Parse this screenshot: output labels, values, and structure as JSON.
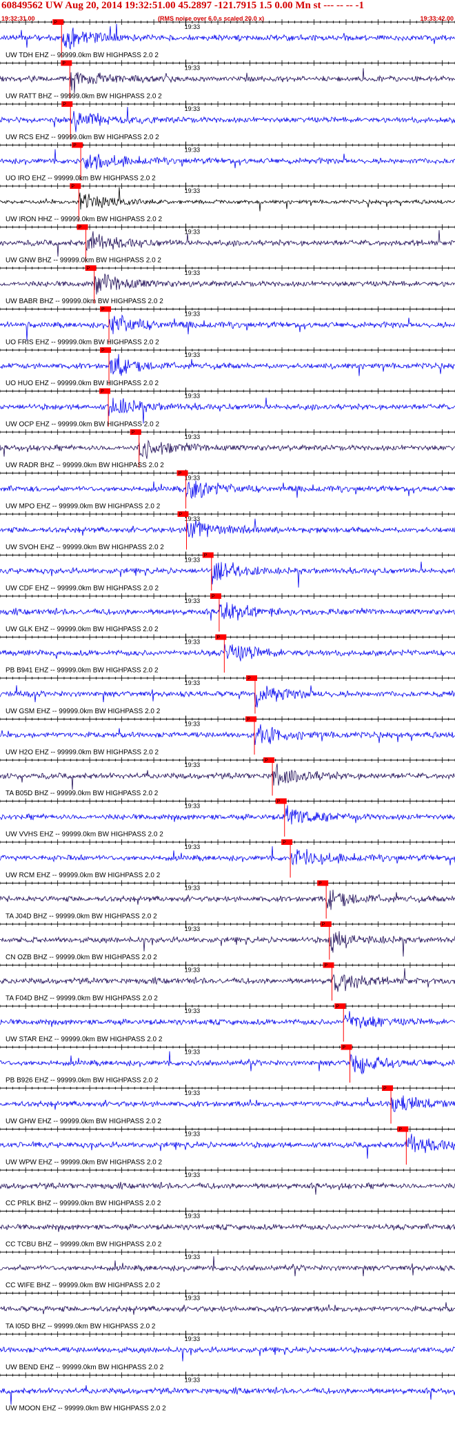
{
  "header": {
    "title": "60849562 UW Aug 20, 2014 19:32:51.00   45.2897 -121.7915  1.5 0.00 Mn st --- -- --   -1",
    "start_time": "19:32:31.00",
    "rms_note": "(RMS noise over 6.0 s scaled 20.0 x)",
    "end_time": "19:33:42.00"
  },
  "colors": {
    "trace_blue": "#0000ee",
    "trace_dark": "#1c0a55",
    "trace_black": "#000000",
    "pick_red": "#ff0000",
    "header_red": "#d40000"
  },
  "chart_data": {
    "type": "line",
    "time_axis": {
      "start": "19:32:31.00",
      "end": "19:33:42.00",
      "minute_label": "19:33"
    },
    "traces": [
      {
        "label": "UW TDH EHZ -- 99999.0km BW  HIGHPASS  2.0  2",
        "pick": "P",
        "pick_t": 9.6,
        "color": "blue"
      },
      {
        "label": "UW RATT BHZ -- 99999.0km BW  HIGHPASS  2.0  2",
        "pick": "P",
        "pick_t": 10.9,
        "color": "dark"
      },
      {
        "label": "UW RCS EHZ -- 99999.0km BW  HIGHPASS  2.0  2",
        "pick": "P",
        "pick_t": 11.0,
        "color": "blue"
      },
      {
        "label": "UO IRO EHZ -- 99999.0km BW  HIGHPASS  2.0  2",
        "pick": "P",
        "pick_t": 12.6,
        "color": "blue"
      },
      {
        "label": "UW IRON HHZ -- 99999.0km BW  HIGHPASS  2.0  2",
        "pick": "P",
        "pick_t": 12.3,
        "color": "black"
      },
      {
        "label": "UW GNW BHZ -- 99999.0km BW  HIGHPASS  2.0  2",
        "pick": "P",
        "pick_t": 13.4,
        "color": "dark"
      },
      {
        "label": "UW BABR BHZ -- 99999.0km BW  HIGHPASS  2.0  2",
        "pick": "P",
        "pick_t": 14.7,
        "color": "dark"
      },
      {
        "label": "UO FRIS EHZ -- 99999.0km BW  HIGHPASS  2.0  2",
        "pick": "P",
        "pick_t": 17.0,
        "color": "blue"
      },
      {
        "label": "UO HUO EHZ -- 99999.0km BW  HIGHPASS  2.0  2",
        "pick": "P",
        "pick_t": 17.0,
        "color": "blue"
      },
      {
        "label": "UW OCP EHZ -- 99999.0km BW  HIGHPASS  2.0  2",
        "pick": "P",
        "pick_t": 16.9,
        "color": "blue"
      },
      {
        "label": "UW RADR BHZ -- 99999.0km BW  HIGHPASS  2.0  2",
        "pick": "P",
        "pick_t": 21.7,
        "color": "dark"
      },
      {
        "label": "UW MPO EHZ -- 99999.0km BW  HIGHPASS  2.0  2",
        "pick": "P",
        "pick_t": 29.0,
        "color": "blue"
      },
      {
        "label": "UW SVOH EHZ -- 99999.0km BW  HIGHPASS  2.0  2",
        "pick": "P",
        "pick_t": 29.1,
        "color": "blue"
      },
      {
        "label": "UW CDF EHZ -- 99999.0km BW  HIGHPASS  2.0  2",
        "pick": "P",
        "pick_t": 33.0,
        "color": "blue"
      },
      {
        "label": "UW GLK EHZ -- 99999.0km BW  HIGHPASS  2.0  2",
        "pick": "P",
        "pick_t": 34.2,
        "color": "blue"
      },
      {
        "label": "PB B941 EHZ -- 99999.0km BW  HIGHPASS  2.0  2",
        "pick": "P",
        "pick_t": 35.0,
        "color": "blue"
      },
      {
        "label": "UW GSM EHZ -- 99999.0km BW  HIGHPASS  2.0  2",
        "pick": "P",
        "pick_t": 39.8,
        "color": "blue"
      },
      {
        "label": "UW H2O EHZ -- 99999.0km BW  HIGHPASS  2.0  2",
        "pick": "P",
        "pick_t": 39.7,
        "color": "blue"
      },
      {
        "label": "TA B05D BHZ -- 99999.0km BW  HIGHPASS  2.0  2",
        "pick": "P",
        "pick_t": 42.5,
        "color": "dark"
      },
      {
        "label": "UW VVHS EHZ -- 99999.0km BW  HIGHPASS  2.0  2",
        "pick": "P",
        "pick_t": 44.4,
        "color": "blue"
      },
      {
        "label": "UW RCM EHZ -- 99999.0km BW  HIGHPASS  2.0  2",
        "pick": "P",
        "pick_t": 45.3,
        "color": "blue"
      },
      {
        "label": "TA J04D BHZ -- 99999.0km BW  HIGHPASS  2.0  2",
        "pick": "P",
        "pick_t": 50.9,
        "color": "dark"
      },
      {
        "label": "CN OZB BHZ -- 99999.0km BW  HIGHPASS  2.0  2",
        "pick": "P",
        "pick_t": 51.4,
        "color": "dark"
      },
      {
        "label": "TA F04D BHZ -- 99999.0km BW  HIGHPASS  2.0  2",
        "pick": "P",
        "pick_t": 51.8,
        "color": "dark"
      },
      {
        "label": "UW STAR EHZ -- 99999.0km BW  HIGHPASS  2.0  2",
        "pick": "P",
        "pick_t": 53.6,
        "color": "blue"
      },
      {
        "label": "PB B926 EHZ -- 99999.0km BW  HIGHPASS  2.0  2",
        "pick": "P",
        "pick_t": 54.6,
        "color": "blue"
      },
      {
        "label": "UW GHW EHZ -- 99999.0km BW  HIGHPASS  2.0  2",
        "pick": "P",
        "pick_t": 61.0,
        "color": "blue"
      },
      {
        "label": "UW WPW EHZ -- 99999.0km BW  HIGHPASS  2.0  2",
        "pick": "P",
        "pick_t": 63.4,
        "color": "blue"
      },
      {
        "label": "CC PRLK BHZ -- 99999.0km BW  HIGHPASS  2.0  2",
        "pick": "",
        "pick_t": null,
        "color": "dark"
      },
      {
        "label": "CC TCBU BHZ -- 99999.0km BW  HIGHPASS  2.0  2",
        "pick": "",
        "pick_t": null,
        "color": "dark"
      },
      {
        "label": "CC WIFE BHZ -- 99999.0km BW  HIGHPASS  2.0  2",
        "pick": "",
        "pick_t": null,
        "color": "dark"
      },
      {
        "label": "TA I05D BHZ -- 99999.0km BW  HIGHPASS  2.0  2",
        "pick": "",
        "pick_t": null,
        "color": "dark"
      },
      {
        "label": "UW BEND EHZ -- 99999.0km BW  HIGHPASS  2.0  2",
        "pick": "",
        "pick_t": null,
        "color": "blue"
      },
      {
        "label": "UW MOON EHZ -- 99999.0km BW  HIGHPASS  2.0  2",
        "pick": "",
        "pick_t": null,
        "color": "blue"
      }
    ]
  }
}
